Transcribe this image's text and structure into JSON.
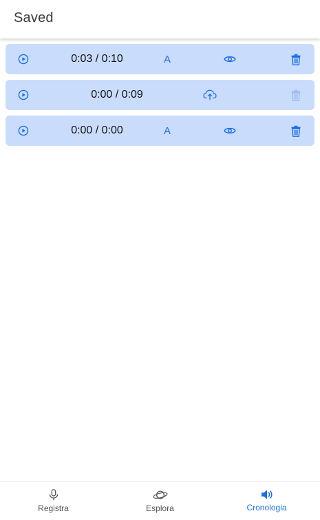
{
  "appbar": {
    "title": "Saved"
  },
  "colors": {
    "accent": "#1a6fe8",
    "row_bg": "#c9dcfb",
    "disabled": "#9fbbee"
  },
  "recordings": [
    {
      "time": "0:03 / 0:10",
      "lang": "A",
      "state": "saved"
    },
    {
      "time": "0:00 / 0:09",
      "lang": "",
      "state": "upload"
    },
    {
      "time": "0:00 / 0:00",
      "lang": "A",
      "state": "saved"
    }
  ],
  "nav": {
    "items": [
      {
        "label": "Registra",
        "icon": "microphone-icon"
      },
      {
        "label": "Esplora",
        "icon": "planet-icon"
      },
      {
        "label": "Cronologia",
        "icon": "volume-icon",
        "active": true
      }
    ]
  }
}
